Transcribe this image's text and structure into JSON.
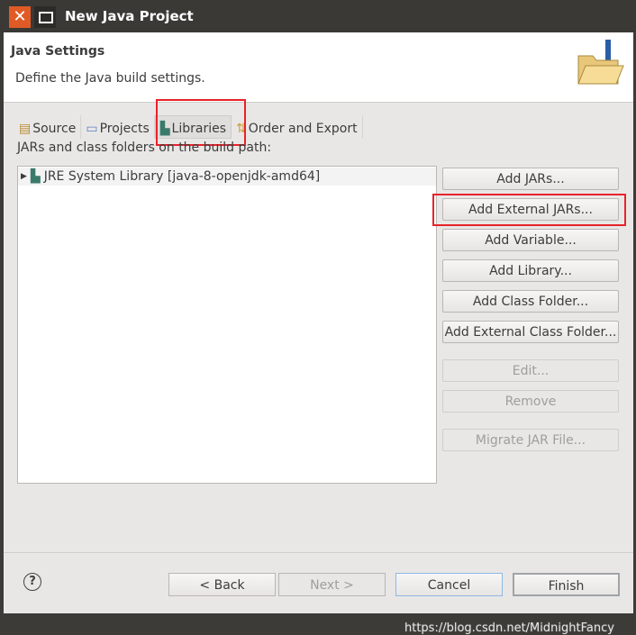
{
  "window": {
    "title": "New Java Project",
    "close_glyph": "✕"
  },
  "header": {
    "title": "Java Settings",
    "description": "Define the Java build settings."
  },
  "tabs": [
    {
      "label": "Source"
    },
    {
      "label": "Projects"
    },
    {
      "label": "Libraries",
      "selected": true
    },
    {
      "label": "Order and Export"
    }
  ],
  "build_path_label": "JARs and class folders on the build path:",
  "entries": [
    {
      "label": "JRE System Library [java-8-openjdk-amd64]"
    }
  ],
  "buttons": {
    "add_jars": "Add JARs...",
    "add_external_jars": "Add External JARs...",
    "add_variable": "Add Variable...",
    "add_library": "Add Library...",
    "add_class_folder": "Add Class Folder...",
    "add_external_class_folder": "Add External Class Folder...",
    "edit": "Edit...",
    "remove": "Remove",
    "migrate": "Migrate JAR File..."
  },
  "footer": {
    "help": "?",
    "back": "< Back",
    "next": "Next >",
    "cancel": "Cancel",
    "finish": "Finish"
  },
  "watermark": "https://blog.csdn.net/MidnightFancy",
  "colors": {
    "highlight": "#e8232a",
    "titlebar": "#3a3935",
    "close": "#e05a26"
  }
}
